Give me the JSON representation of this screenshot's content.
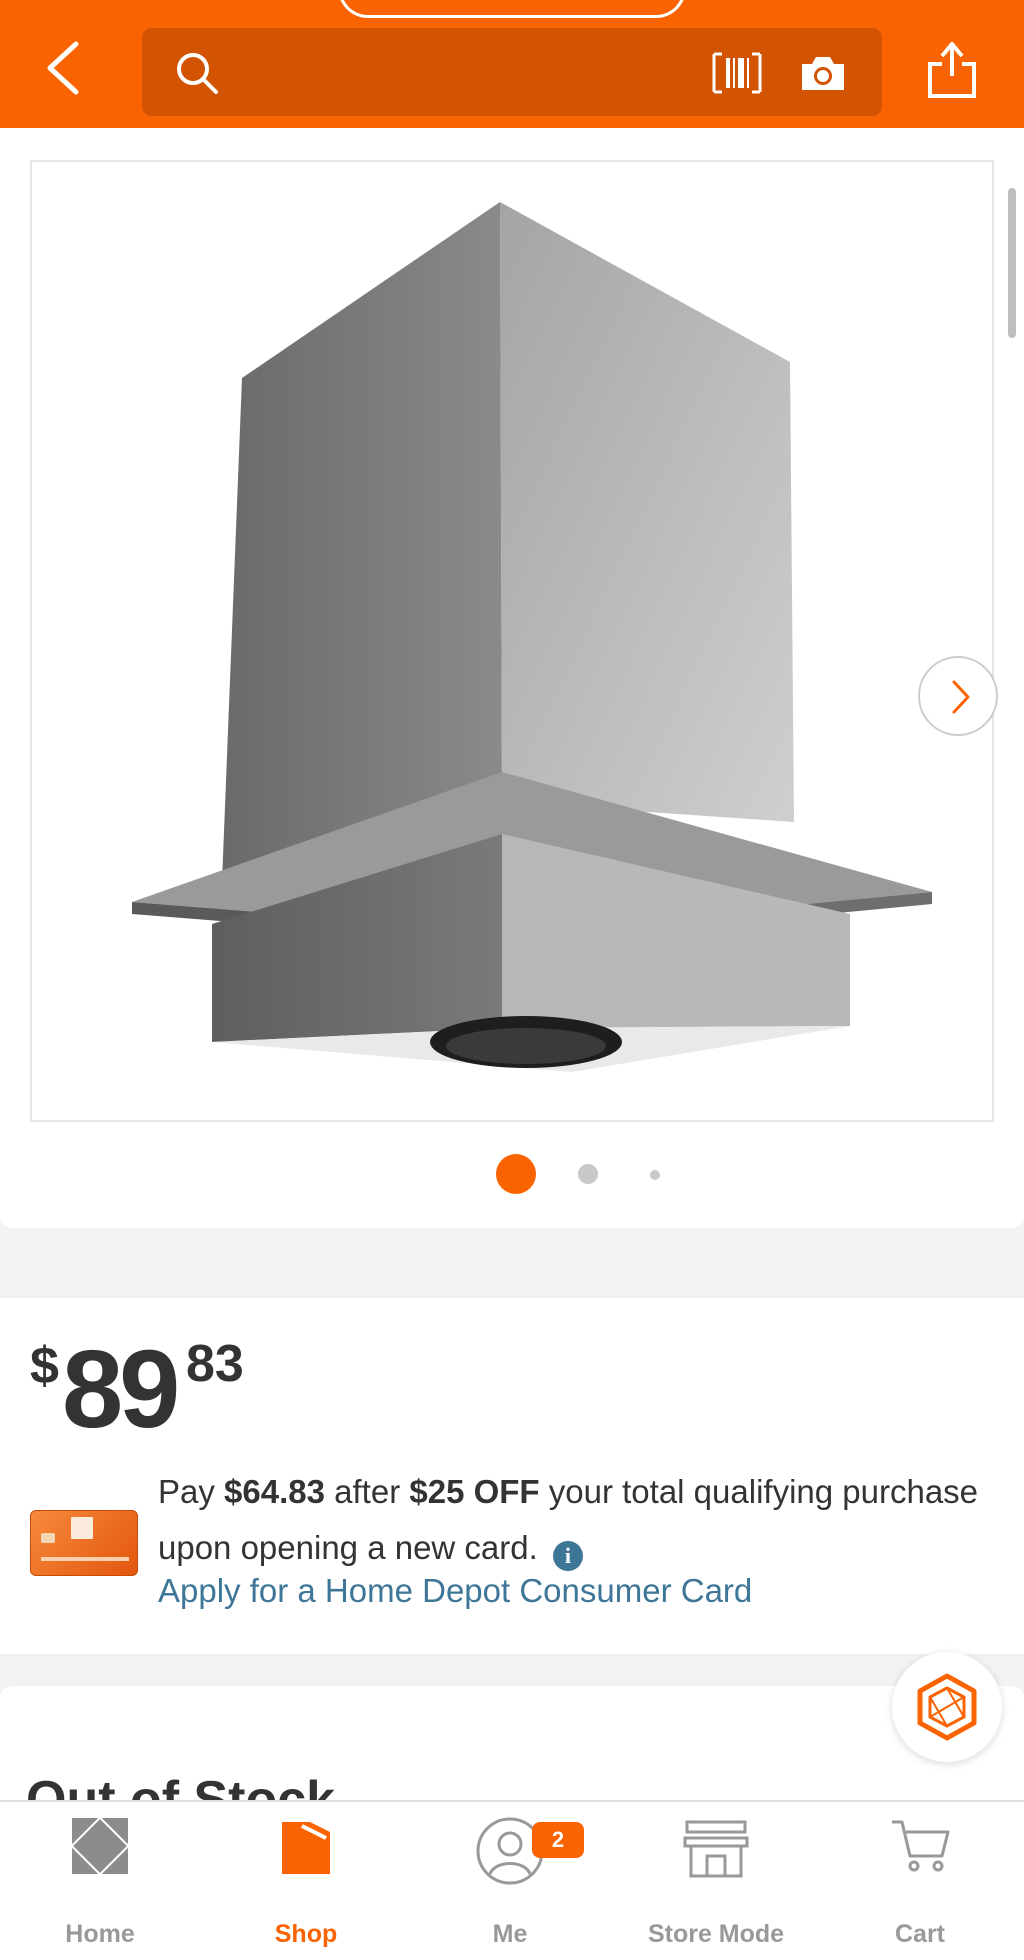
{
  "header": {
    "back_icon": "chevron-left-icon",
    "search_icon": "search-icon",
    "barcode_icon": "barcode-scan-icon",
    "camera_icon": "camera-icon",
    "share_icon": "share-icon",
    "search_placeholder": ""
  },
  "gallery": {
    "image_count": 3,
    "current_index": 1,
    "next_icon": "chevron-right-icon"
  },
  "price": {
    "currency": "$",
    "dollars": "89",
    "cents": "83"
  },
  "promo": {
    "pay": "Pay",
    "amount_after": "$64.83",
    "after": "after",
    "discount": "$25 OFF",
    "rest": "your total qualifying purchase upon opening a new card.",
    "info_glyph": "i",
    "apply_link": "Apply for a Home Depot Consumer Card"
  },
  "stock": {
    "title": "Out of Stock"
  },
  "bottom_nav": {
    "items": [
      {
        "label": "Home",
        "icon": "home-depot-logo-icon",
        "active": false
      },
      {
        "label": "Shop",
        "icon": "shop-tag-icon",
        "active": true
      },
      {
        "label": "Me",
        "icon": "user-icon",
        "active": false,
        "badge": "2"
      },
      {
        "label": "Store Mode",
        "icon": "store-icon",
        "active": false
      },
      {
        "label": "Cart",
        "icon": "cart-icon",
        "active": false
      }
    ]
  },
  "colors": {
    "brand_orange": "#f96302",
    "search_bg": "#d25302",
    "link_blue": "#3e7697",
    "text": "#333333",
    "inactive": "#999999"
  }
}
